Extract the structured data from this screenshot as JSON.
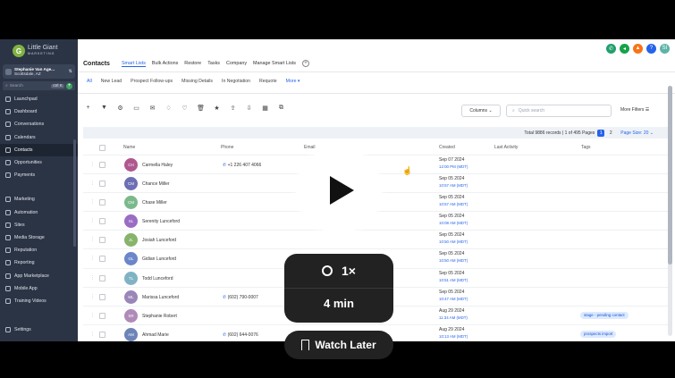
{
  "colors": {
    "sidebar_bg": "#2b3445",
    "accent": "#2563eb",
    "page_bg": "#000000"
  },
  "sidebar": {
    "brand": "Little Giant",
    "brand_sub": "MARKETING",
    "account_name": "Stephanie Van Age...",
    "account_location": "Scottsdale, AZ",
    "search_placeholder": "Search",
    "search_shortcut": "ctrl K",
    "items": [
      {
        "label": "Launchpad"
      },
      {
        "label": "Dashboard"
      },
      {
        "label": "Conversations"
      },
      {
        "label": "Calendars"
      },
      {
        "label": "Contacts",
        "active": true
      },
      {
        "label": "Opportunities"
      },
      {
        "label": "Payments"
      },
      {
        "label": "Marketing"
      },
      {
        "label": "Automation"
      },
      {
        "label": "Sites"
      },
      {
        "label": "Media Storage"
      },
      {
        "label": "Reputation"
      },
      {
        "label": "Reporting"
      },
      {
        "label": "App Marketplace"
      },
      {
        "label": "Mobile App"
      },
      {
        "label": "Training Videos"
      }
    ],
    "settings": "Settings"
  },
  "header": {
    "title": "Contacts",
    "tabs": [
      "Smart Lists",
      "Bulk Actions",
      "Restore",
      "Tasks",
      "Company",
      "Manage Smart Lists"
    ]
  },
  "list_tabs": [
    "All",
    "New Lead",
    "Prospect Follow-ups",
    "Missing Details",
    "In Negotiation",
    "Requote"
  ],
  "list_tabs_more": "More",
  "controls": {
    "columns": "Columns",
    "quick_search": "Quick search",
    "more_filters": "More Filters"
  },
  "summary": {
    "text": "Total 9886 records | 1 of 495 Pages",
    "page1": "1",
    "page2": "2",
    "page_size": "Page Size: 20"
  },
  "table": {
    "headers": [
      "Name",
      "Phone",
      "Email",
      "Created",
      "Last Activity",
      "Tags"
    ],
    "rows": [
      {
        "initials": "CH",
        "color": "#b0578f",
        "name": "Carmella Haley",
        "phone": "+1 226 407 4066",
        "date": "Sep 07 2024",
        "time": "12:00 PM (MDT)",
        "tag": ""
      },
      {
        "initials": "CM",
        "color": "#6d6fb5",
        "name": "Chance Miller",
        "phone": "",
        "date": "Sep 05 2024",
        "time": "10:57 AM (MDT)",
        "tag": ""
      },
      {
        "initials": "CM",
        "color": "#7bb98b",
        "name": "Chase Miller",
        "phone": "",
        "date": "Sep 05 2024",
        "time": "10:57 AM (MDT)",
        "tag": ""
      },
      {
        "initials": "SL",
        "color": "#9a6cc3",
        "name": "Serenity Lunceford",
        "phone": "",
        "date": "Sep 05 2024",
        "time": "10:08 AM (MDT)",
        "tag": ""
      },
      {
        "initials": "JL",
        "color": "#88b36b",
        "name": "Josiah Lunceford",
        "phone": "",
        "date": "Sep 05 2024",
        "time": "10:50 AM (MDT)",
        "tag": ""
      },
      {
        "initials": "GL",
        "color": "#6b86c9",
        "name": "Gidian Lunceford",
        "phone": "",
        "date": "Sep 05 2024",
        "time": "10:50 AM (MDT)",
        "tag": ""
      },
      {
        "initials": "TL",
        "color": "#7fb3c4",
        "name": "Todd Lunceford",
        "phone": "",
        "date": "Sep 05 2024",
        "time": "10:51 AM (MDT)",
        "tag": ""
      },
      {
        "initials": "ML",
        "color": "#9a86b8",
        "name": "Marissa Lunceford",
        "phone": "(602) 790-0007",
        "date": "Sep 05 2024",
        "time": "10:47 AM (MDT)",
        "tag": ""
      },
      {
        "initials": "SR",
        "color": "#b08ab8",
        "name": "Stephanie Robert",
        "phone": "",
        "date": "Aug 29 2024",
        "time": "11:34 AM (MDT)",
        "tag": "stage - pending contact"
      },
      {
        "initials": "AM",
        "color": "#6c84b8",
        "name": "Ahmad Marie",
        "phone": "(602) 644-0076",
        "date": "Aug 29 2024",
        "time": "10:13 AM (MDT)",
        "tag": "prospects import"
      }
    ]
  },
  "video_overlay": {
    "speed": "1×",
    "duration": "4 min",
    "watch_later": "Watch Later"
  }
}
